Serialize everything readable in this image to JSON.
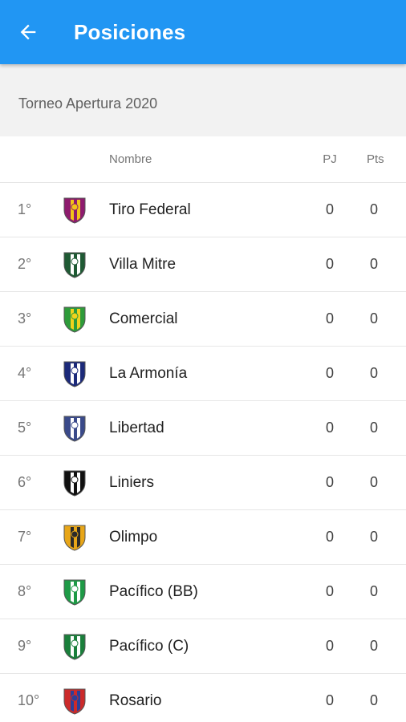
{
  "appbar": {
    "title": "Posiciones",
    "back_icon": "arrow-left-icon"
  },
  "tournament": {
    "title": "Torneo Apertura 2020"
  },
  "table": {
    "headers": {
      "name": "Nombre",
      "pj": "PJ",
      "pts": "Pts"
    },
    "rows": [
      {
        "pos": "1°",
        "name": "Tiro Federal",
        "pj": "0",
        "pts": "0",
        "crest_colors": [
          "#8e1b6e",
          "#f2c418"
        ]
      },
      {
        "pos": "2°",
        "name": "Villa Mitre",
        "pj": "0",
        "pts": "0",
        "crest_colors": [
          "#1f5a34",
          "#ffffff"
        ]
      },
      {
        "pos": "3°",
        "name": "Comercial",
        "pj": "0",
        "pts": "0",
        "crest_colors": [
          "#2e9b3a",
          "#f3d21d"
        ]
      },
      {
        "pos": "4°",
        "name": "La Armonía",
        "pj": "0",
        "pts": "0",
        "crest_colors": [
          "#1c2a7a",
          "#ffffff"
        ]
      },
      {
        "pos": "5°",
        "name": "Libertad",
        "pj": "0",
        "pts": "0",
        "crest_colors": [
          "#3a4a8a",
          "#ffffff"
        ]
      },
      {
        "pos": "6°",
        "name": "Liniers",
        "pj": "0",
        "pts": "0",
        "crest_colors": [
          "#111111",
          "#ffffff"
        ]
      },
      {
        "pos": "7°",
        "name": "Olimpo",
        "pj": "0",
        "pts": "0",
        "crest_colors": [
          "#e8a618",
          "#2b2b2b"
        ]
      },
      {
        "pos": "8°",
        "name": "Pacífico (BB)",
        "pj": "0",
        "pts": "0",
        "crest_colors": [
          "#1e9a46",
          "#ffffff"
        ]
      },
      {
        "pos": "9°",
        "name": "Pacífico (C)",
        "pj": "0",
        "pts": "0",
        "crest_colors": [
          "#1a7f3b",
          "#ffffff"
        ]
      },
      {
        "pos": "10°",
        "name": "Rosario",
        "pj": "0",
        "pts": "0",
        "crest_colors": [
          "#cc2a2a",
          "#2b3f9a"
        ]
      }
    ]
  }
}
